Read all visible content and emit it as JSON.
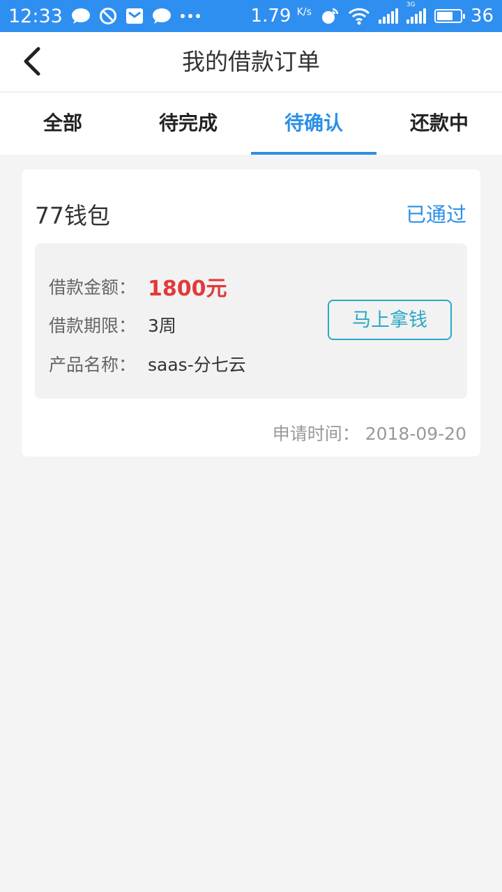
{
  "status_bar": {
    "time": "12:33",
    "speed": "1.79",
    "speed_unit": "K/s",
    "battery": "36",
    "battery_level_percent": 70,
    "network_label": "3G"
  },
  "header": {
    "title": "我的借款订单"
  },
  "tabs": [
    {
      "label": "全部",
      "active": false
    },
    {
      "label": "待完成",
      "active": false
    },
    {
      "label": "待确认",
      "active": true
    },
    {
      "label": "还款中",
      "active": false
    }
  ],
  "order": {
    "product": "77钱包",
    "status": "已通过",
    "amount_label": "借款金额：",
    "amount_value": "1800元",
    "term_label": "借款期限：",
    "term_value": "3周",
    "name_label": "产品名称：",
    "name_value": "saas-分七云",
    "button_label": "马上拿钱",
    "apply_time_label": "申请时间：",
    "apply_time_value": "2018-09-20"
  },
  "colors": {
    "status_bar": "#2f8ff0",
    "accent": "#2b8fe6",
    "amount": "#e23a3a",
    "button": "#2aa7c8"
  },
  "icons": [
    "chat-bubble-icon",
    "block-icon",
    "mail-icon",
    "more-dots-icon",
    "hotspot-icon",
    "wifi-icon",
    "signal-icon",
    "battery-icon",
    "back-arrow-icon"
  ]
}
